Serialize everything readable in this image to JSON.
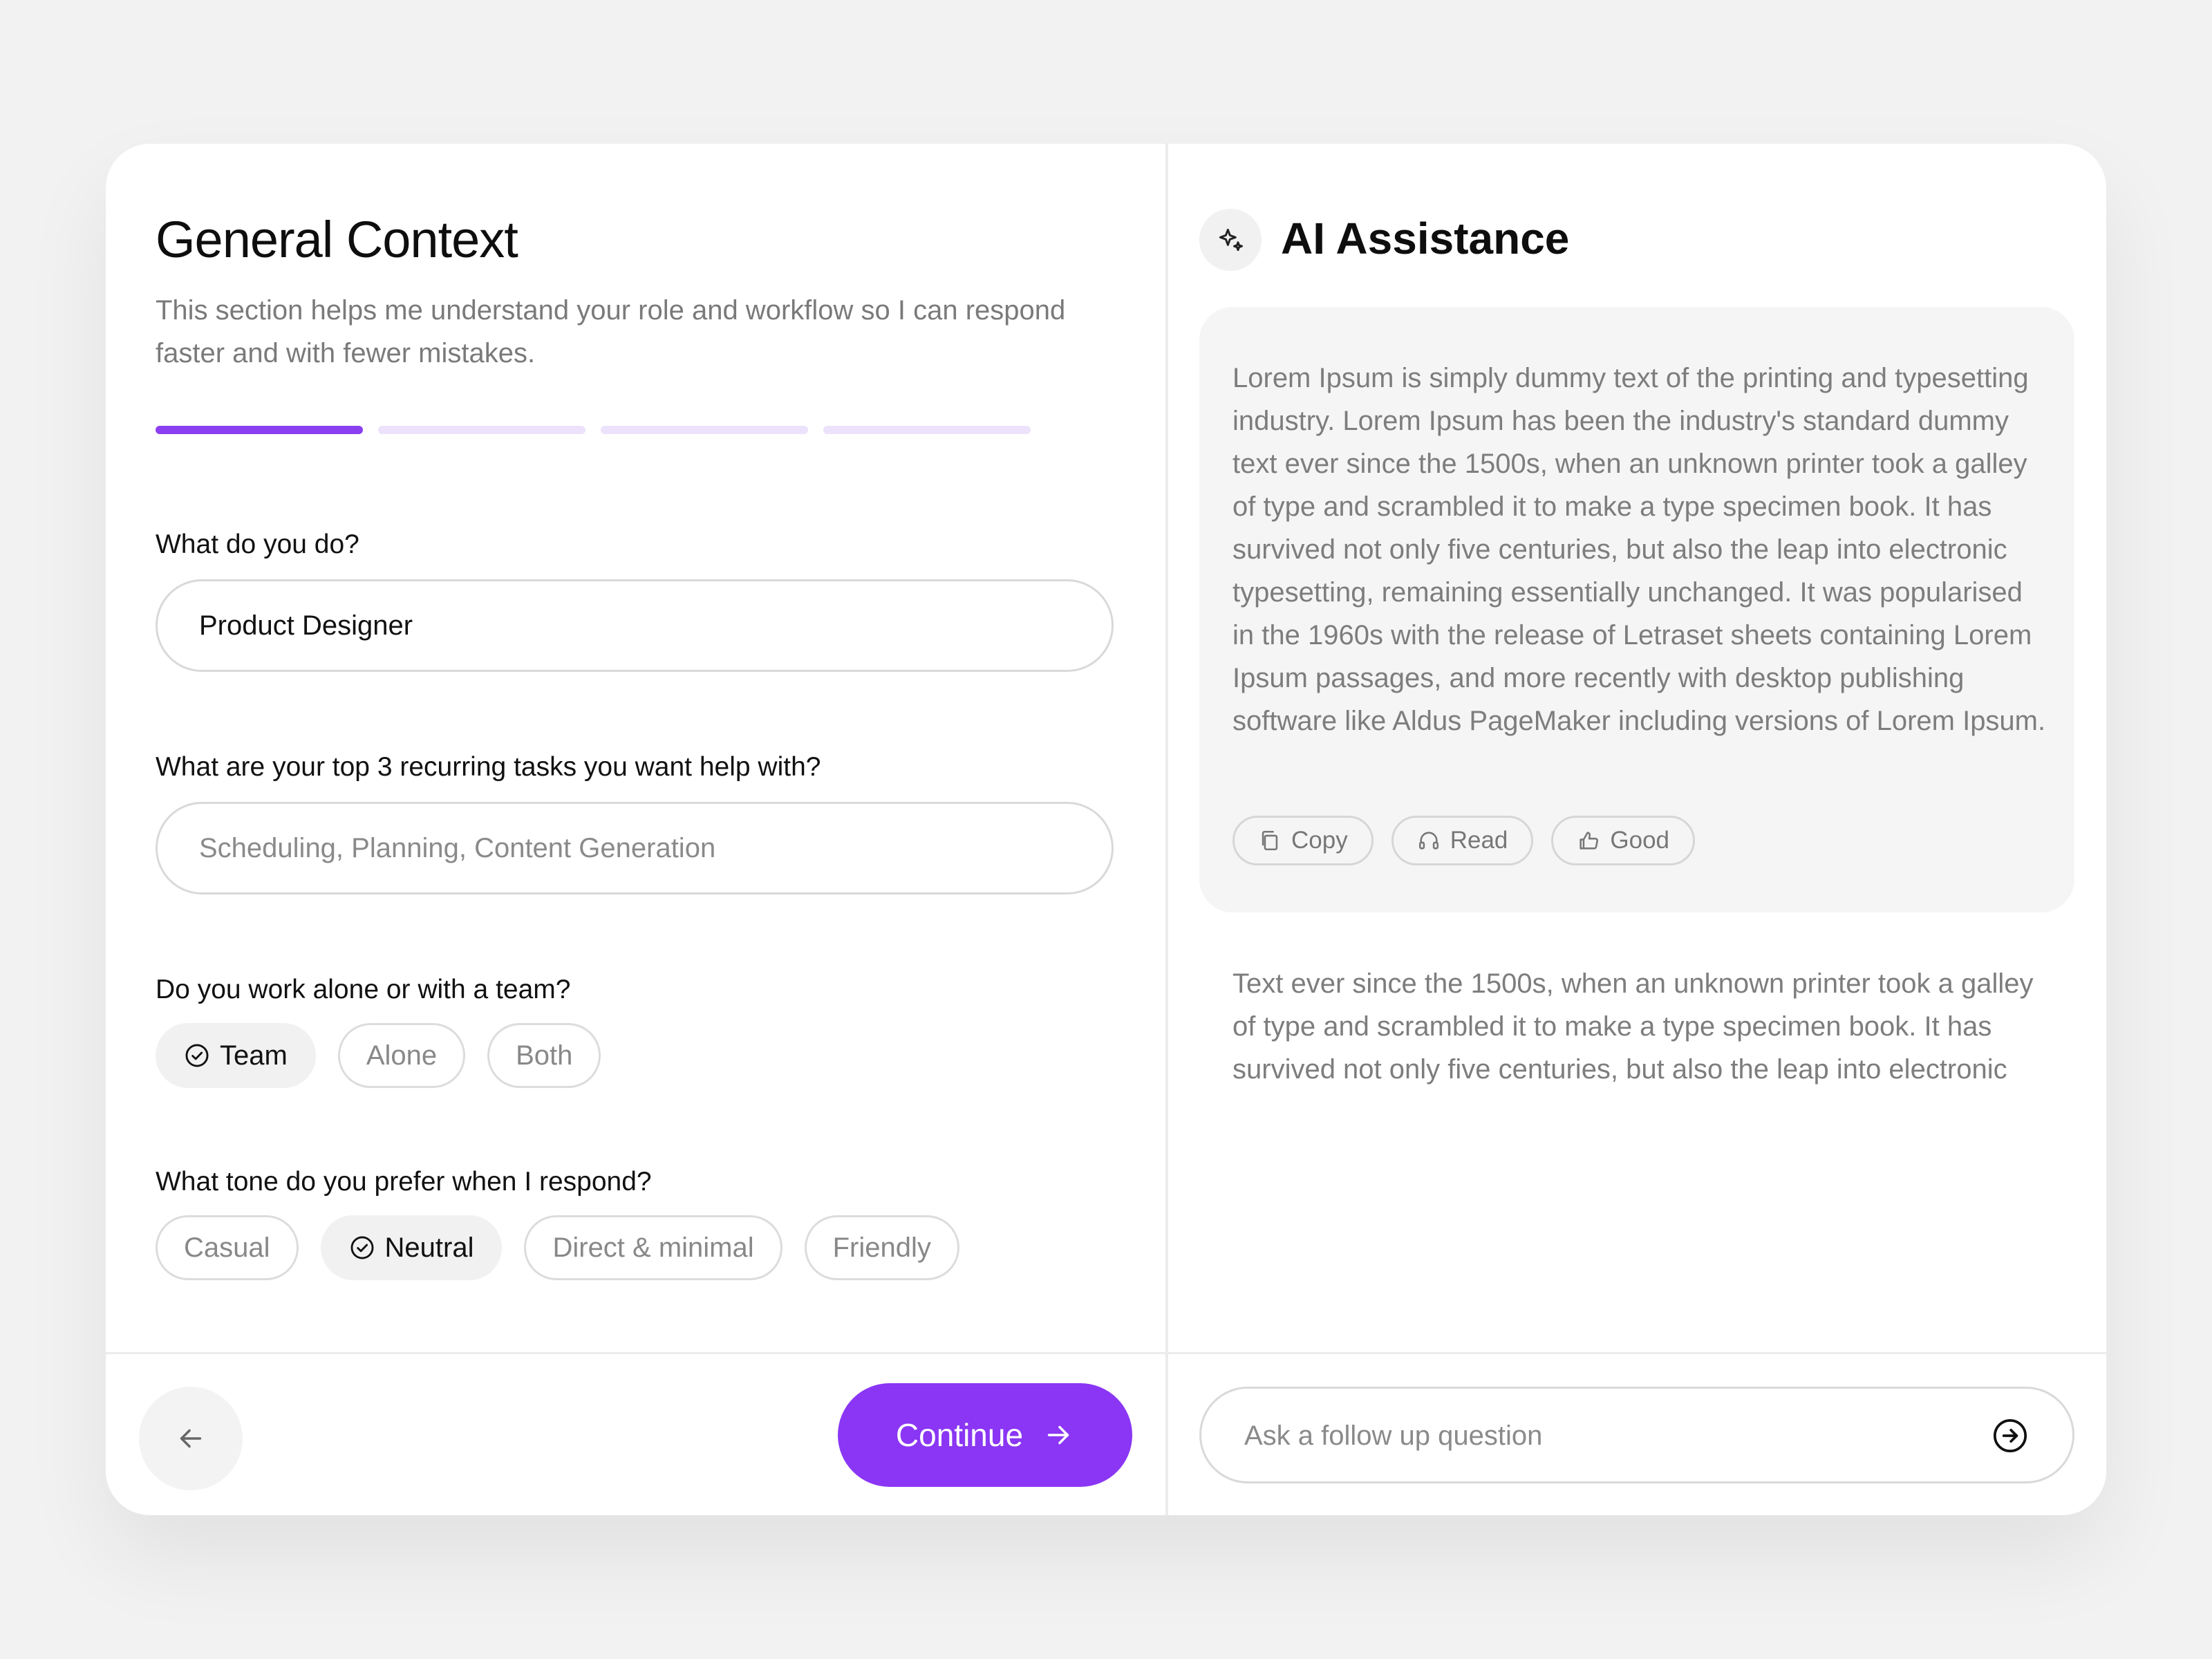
{
  "left": {
    "title": "General Context",
    "subtitle": "This section helps me understand your role and workflow so I can respond faster and with fewer mistakes.",
    "progress": {
      "total_steps": 4,
      "current_step": 1,
      "accent": "#8a3ff0",
      "inactive": "#ece2fb"
    },
    "q1": {
      "label": "What do you do?",
      "value": "Product Designer"
    },
    "q2": {
      "label": "What are your top 3 recurring tasks you want help with?",
      "placeholder": "Scheduling, Planning, Content Generation"
    },
    "q3": {
      "label": "Do you work alone or with a team?",
      "options": [
        "Team",
        "Alone",
        "Both"
      ],
      "selected": "Team"
    },
    "q4": {
      "label": "What tone do you prefer when I respond?",
      "options": [
        "Casual",
        "Neutral",
        "Direct & minimal",
        "Friendly"
      ],
      "selected": "Neutral"
    },
    "back_icon": "arrow-left-icon",
    "continue_label": "Continue",
    "continue_icon": "arrow-right-icon",
    "continue_color": "#8a36f4"
  },
  "right": {
    "title": "AI Assistance",
    "title_icon": "sparkles-icon",
    "response": "Lorem Ipsum is simply dummy text of the printing and typesetting industry. Lorem Ipsum has been the industry's standard dummy text ever since the 1500s, when an unknown printer took a galley of type and scrambled it to make a type specimen book. It has survived not only five centuries, but also the leap into electronic typesetting, remaining essentially unchanged. It was popularised in the 1960s with the release of Letraset sheets containing Lorem Ipsum passages, and more recently with desktop publishing software like Aldus PageMaker including versions of Lorem Ipsum.",
    "actions": {
      "copy": "Copy",
      "read": "Read",
      "good": "Good"
    },
    "followup": "Text ever since the 1500s, when an unknown printer took a galley of type and scrambled it to make a type specimen book. It has survived not only five centuries, but also the leap into electronic",
    "ask_placeholder": "Ask a follow up question",
    "send_icon": "arrow-right-circle-icon"
  }
}
